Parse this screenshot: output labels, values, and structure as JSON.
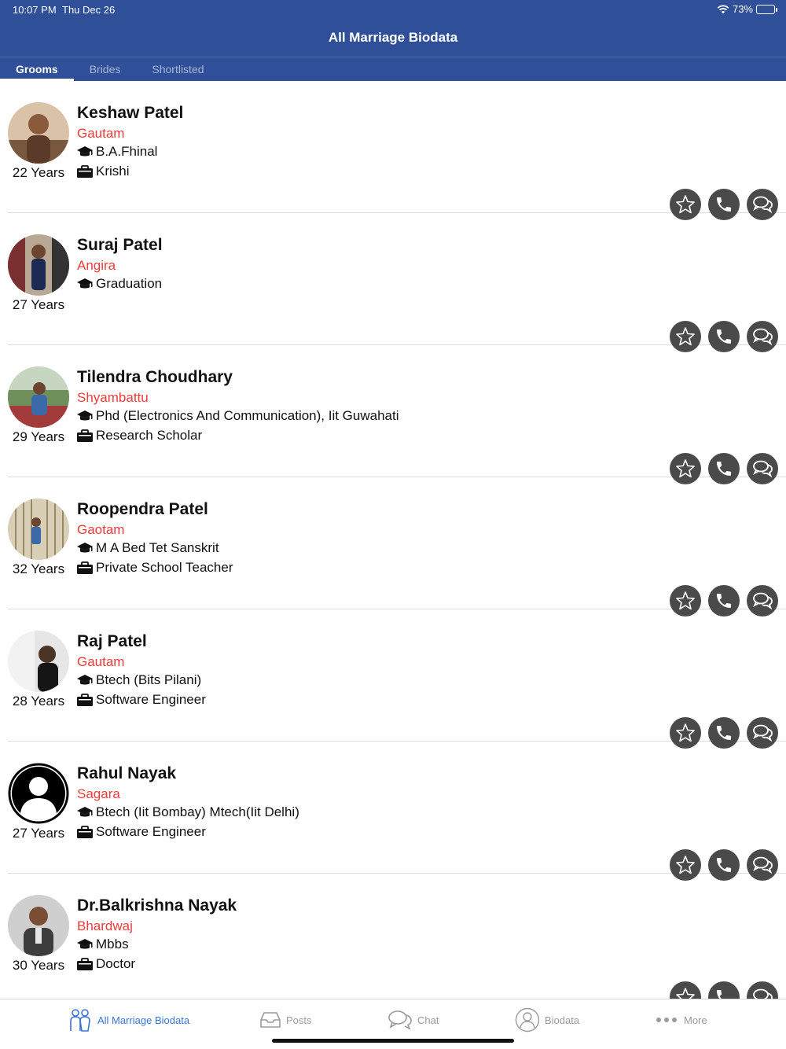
{
  "status": {
    "time": "10:07 PM",
    "date": "Thu Dec 26",
    "battery": "73%"
  },
  "header": {
    "title": "All Marriage Biodata"
  },
  "tabs": [
    {
      "label": "Grooms",
      "active": true
    },
    {
      "label": "Brides",
      "active": false
    },
    {
      "label": "Shortlisted",
      "active": false
    }
  ],
  "profiles": [
    {
      "name": "Keshaw Patel",
      "gotra": "Gautam",
      "education": "B.A.Fhinal",
      "occupation": "Krishi",
      "age": "22 Years"
    },
    {
      "name": "Suraj Patel",
      "gotra": "Angira",
      "education": "Graduation",
      "occupation": "",
      "age": "27 Years"
    },
    {
      "name": "Tilendra Choudhary",
      "gotra": "Shyambattu",
      "education": "Phd (Electronics And Communication), Iit Guwahati",
      "occupation": "Research Scholar",
      "age": "29 Years"
    },
    {
      "name": "Roopendra Patel",
      "gotra": "Gaotam",
      "education": "M A Bed Tet Sanskrit",
      "occupation": "Private School Teacher",
      "age": "32 Years"
    },
    {
      "name": "Raj Patel",
      "gotra": "Gautam",
      "education": "Btech (Bits Pilani)",
      "occupation": "Software Engineer",
      "age": "28 Years"
    },
    {
      "name": "Rahul Nayak",
      "gotra": "Sagara",
      "education": "Btech (Iit Bombay) Mtech(Iit Delhi)",
      "occupation": "Software Engineer",
      "age": "27 Years"
    },
    {
      "name": "Dr.Balkrishna Nayak",
      "gotra": "Bhardwaj",
      "education": "Mbbs",
      "occupation": "Doctor",
      "age": "30 Years"
    }
  ],
  "bottom_nav": [
    {
      "label": "All Marriage Biodata",
      "icon": "couple-icon",
      "active": true
    },
    {
      "label": "Posts",
      "icon": "inbox-icon",
      "active": false
    },
    {
      "label": "Chat",
      "icon": "chat-icon",
      "active": false
    },
    {
      "label": "Biodata",
      "icon": "person-icon",
      "active": false
    },
    {
      "label": "More",
      "icon": "more-dots-icon",
      "active": false
    }
  ],
  "colors": {
    "header": "#2f4f98",
    "gotra": "#ee3b3b",
    "active_nav": "#3a73d8",
    "action_button": "#4a4a4a"
  }
}
